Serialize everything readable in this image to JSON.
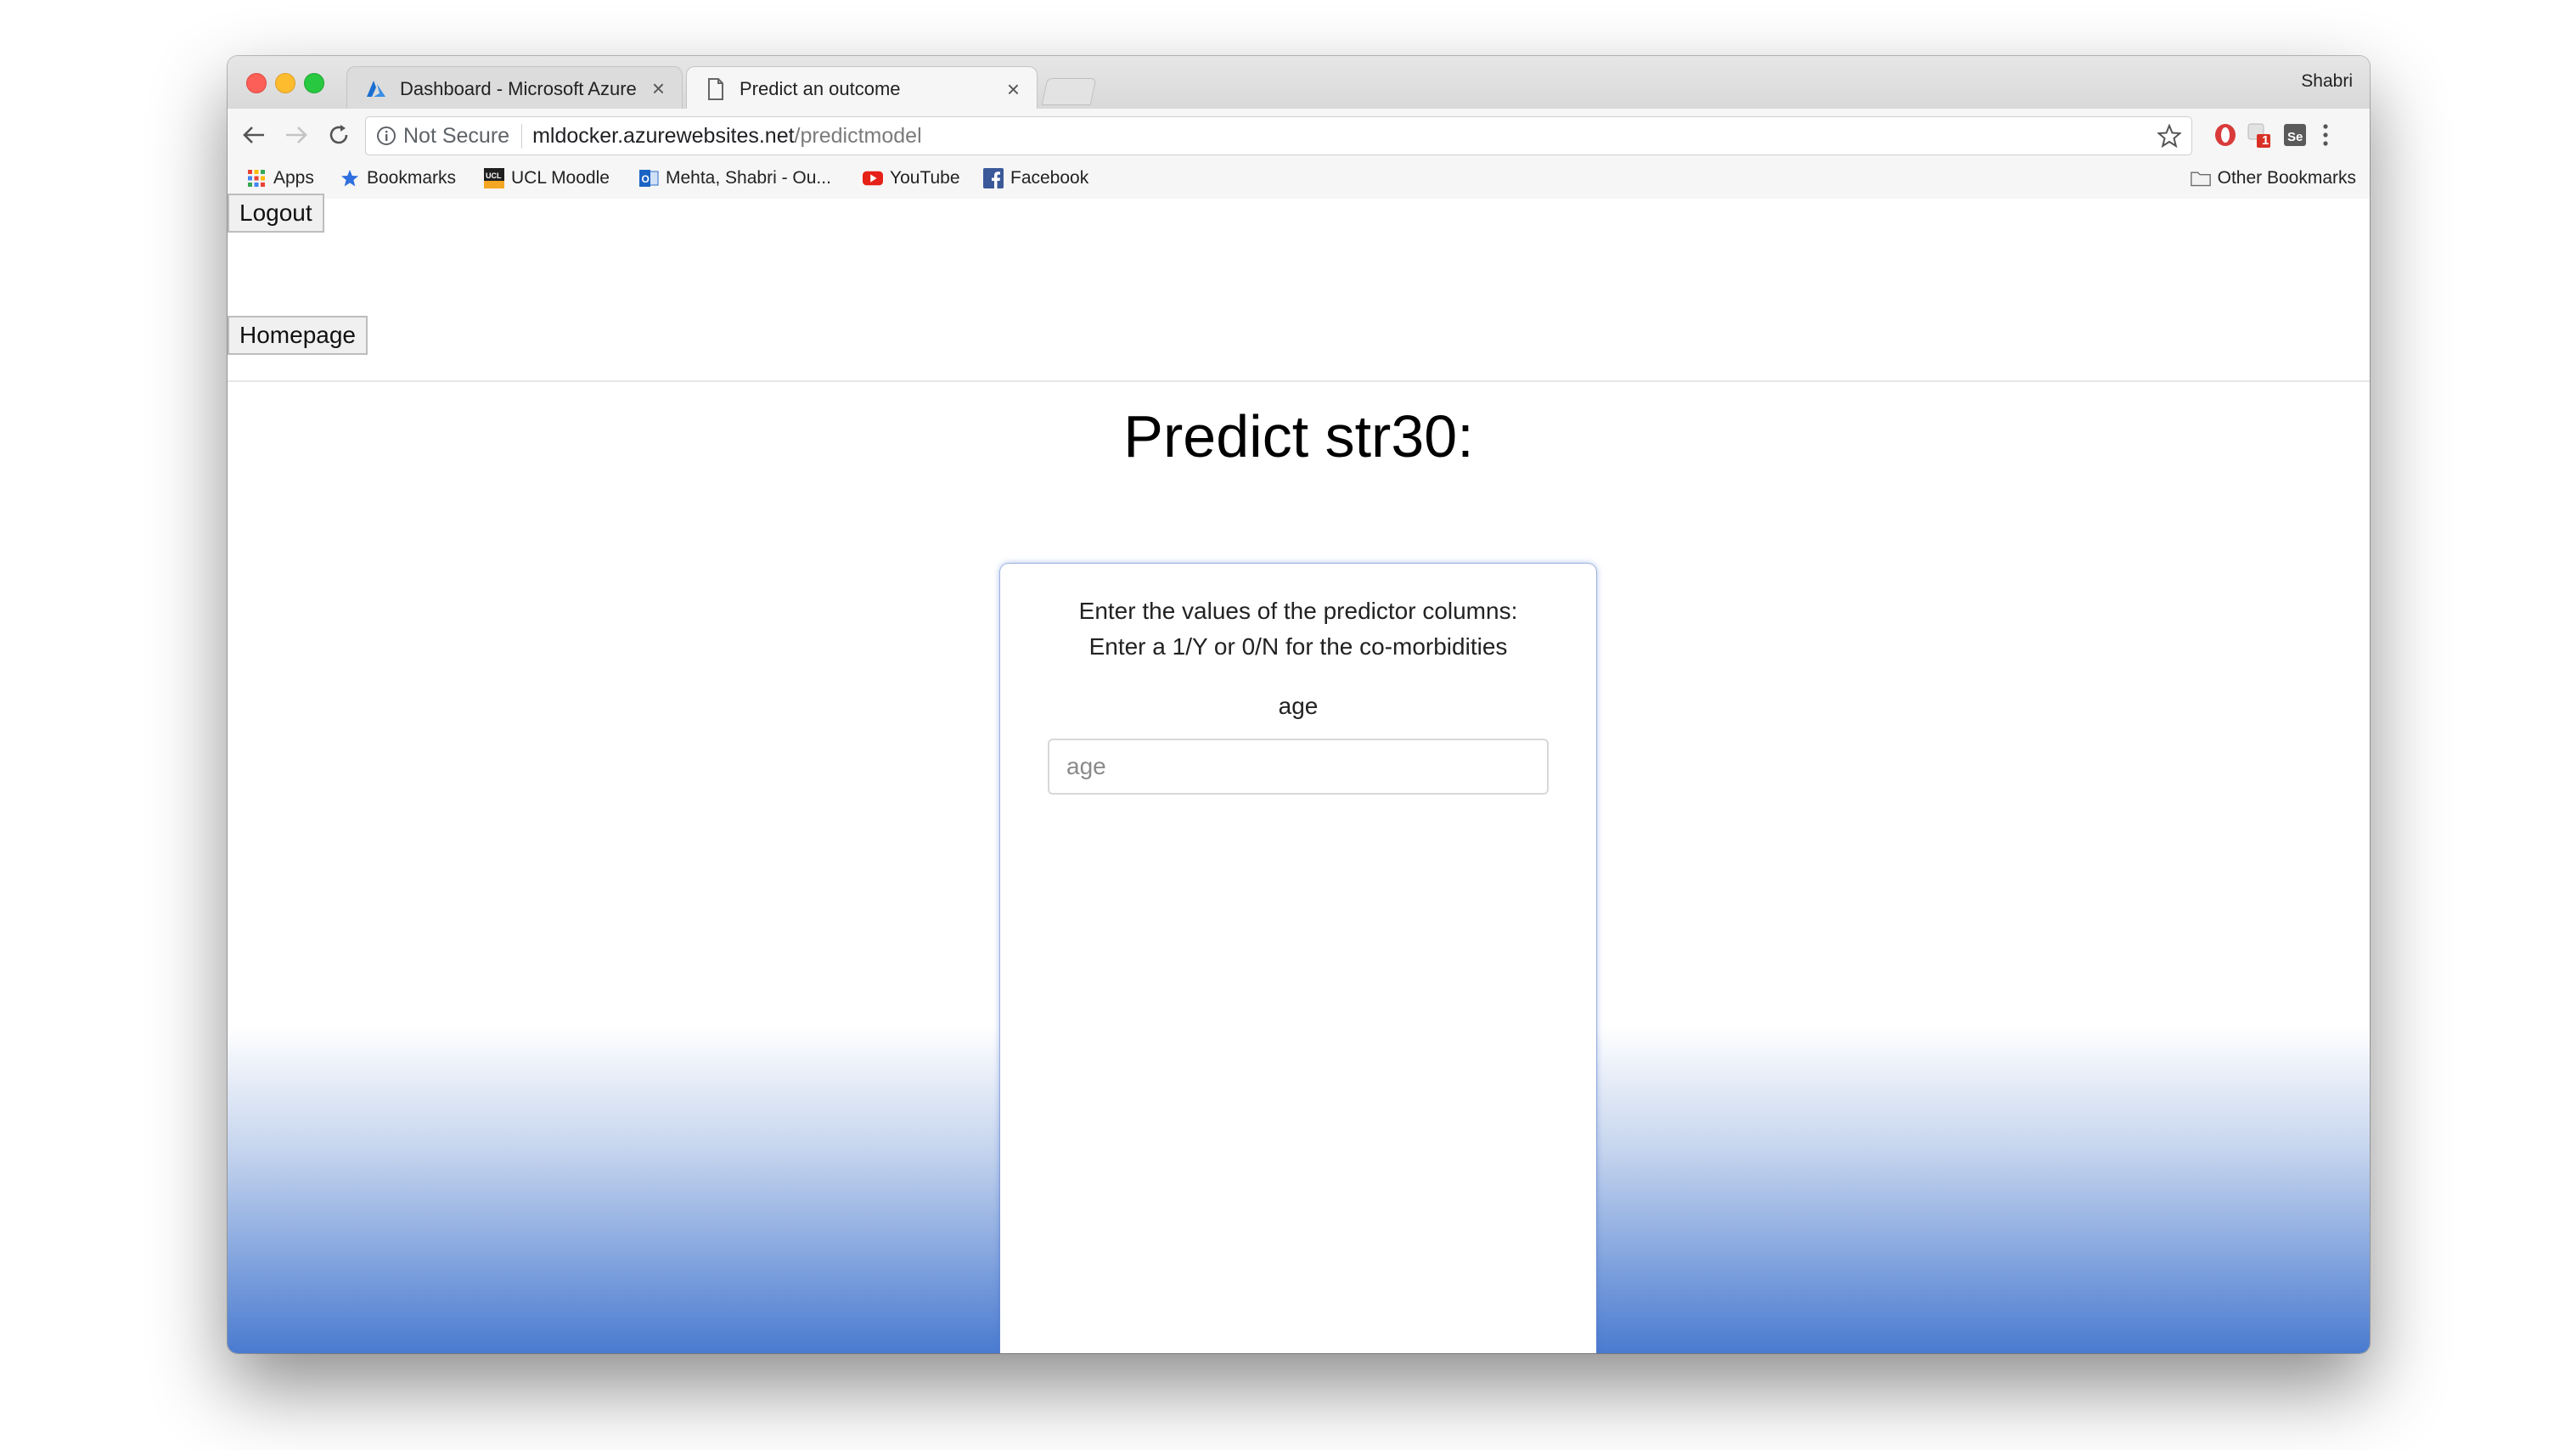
{
  "browser": {
    "profile_name": "Shabri",
    "tabs": [
      {
        "title": "Dashboard - Microsoft Azure",
        "icon": "azure-icon",
        "active": false
      },
      {
        "title": "Predict an outcome",
        "icon": "page-icon",
        "active": true
      }
    ],
    "close_glyph": "×",
    "security_label": "Not Secure",
    "url_host": "mldocker.azurewebsites.net",
    "url_path": "/predictmodel",
    "extension_badge": "1",
    "bookmarks": [
      {
        "label": "Apps",
        "icon": "apps-grid-icon"
      },
      {
        "label": "Bookmarks",
        "icon": "star-icon"
      },
      {
        "label": "UCL Moodle",
        "icon": "ucl-icon"
      },
      {
        "label": "Mehta, Shabri - Ou...",
        "icon": "outlook-icon"
      },
      {
        "label": "YouTube",
        "icon": "youtube-icon"
      },
      {
        "label": "Facebook",
        "icon": "facebook-icon"
      }
    ],
    "other_bookmarks": "Other Bookmarks"
  },
  "page": {
    "logout_label": "Logout",
    "homepage_label": "Homepage",
    "title": "Predict str30:",
    "instructions_line1": "Enter the values of the predictor columns:",
    "instructions_line2": "Enter a 1/Y or 0/N for the co-morbidities",
    "field_label": "age",
    "field_placeholder": "age",
    "field_value": ""
  },
  "colors": {
    "gradient_bottom": "#4a7bd0",
    "card_glow": "#6e8fd8"
  }
}
